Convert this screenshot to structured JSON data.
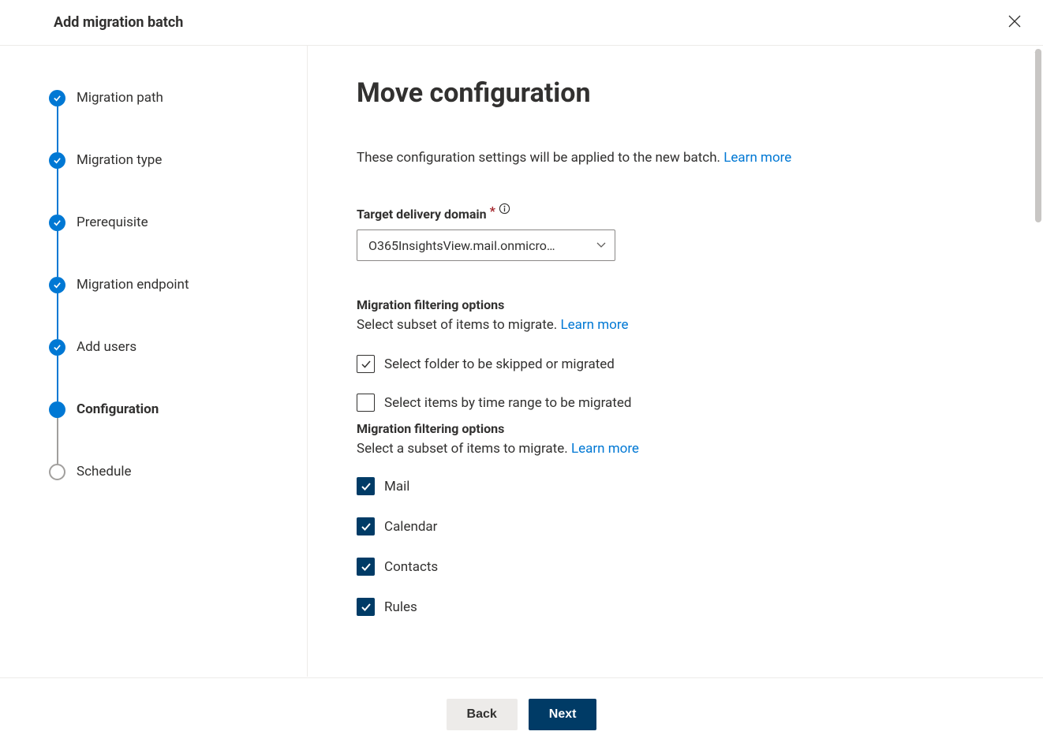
{
  "header": {
    "title": "Add migration batch"
  },
  "steps": [
    {
      "label": "Migration path",
      "state": "completed"
    },
    {
      "label": "Migration type",
      "state": "completed"
    },
    {
      "label": "Prerequisite",
      "state": "completed"
    },
    {
      "label": "Migration endpoint",
      "state": "completed"
    },
    {
      "label": "Add users",
      "state": "completed"
    },
    {
      "label": "Configuration",
      "state": "current"
    },
    {
      "label": "Schedule",
      "state": "upcoming"
    }
  ],
  "main": {
    "heading": "Move configuration",
    "description": "These configuration settings will be applied to the new batch. ",
    "learn_more": "Learn more",
    "target_domain_label": "Target delivery domain",
    "target_domain_value": "O365InsightsView.mail.onmicro…",
    "filter_options_heading_1": "Migration filtering options",
    "filter_options_sub_1": "Select subset of items to migrate. ",
    "cb_folder_label": "Select folder to be skipped or migrated",
    "cb_folder_checked": true,
    "cb_timerange_label": "Select items by time range to be migrated",
    "cb_timerange_checked": false,
    "filter_options_heading_2": "Migration filtering options",
    "filter_options_sub_2": "Select a subset of items to migrate. ",
    "filter_items": [
      {
        "label": "Mail",
        "checked": true
      },
      {
        "label": "Calendar",
        "checked": true
      },
      {
        "label": "Contacts",
        "checked": true
      },
      {
        "label": "Rules",
        "checked": true
      }
    ]
  },
  "footer": {
    "back": "Back",
    "next": "Next"
  }
}
